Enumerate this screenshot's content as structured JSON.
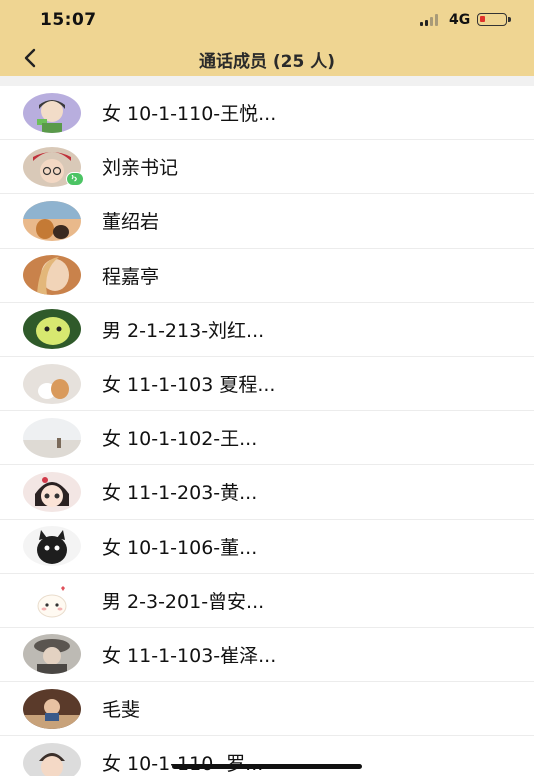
{
  "status_bar": {
    "time": "15:07",
    "network": "4G",
    "battery_color": "#e0322b"
  },
  "header": {
    "title": "通话成员 (25 人)",
    "background": "#efd592"
  },
  "members": [
    {
      "name": "女 10-1-110-王悦...",
      "avatar": "cartoon-girl"
    },
    {
      "name": "刘亲书记",
      "avatar": "child-glasses",
      "speaking": true
    },
    {
      "name": "董绍岩",
      "avatar": "dogs-sunset"
    },
    {
      "name": "程嘉亭",
      "avatar": "blonde-woman"
    },
    {
      "name": "男 2-1-213-刘红...",
      "avatar": "green-creature"
    },
    {
      "name": "女 11-1-103 夏程...",
      "avatar": "kittens"
    },
    {
      "name": "女 10-1-102-王...",
      "avatar": "beach-dog"
    },
    {
      "name": "女 11-1-203-黄...",
      "avatar": "anime-girl"
    },
    {
      "name": "女 10-1-106-董...",
      "avatar": "black-cat"
    },
    {
      "name": "男 2-3-201-曾安...",
      "avatar": "cute-bun"
    },
    {
      "name": "女 11-1-103-崔泽...",
      "avatar": "person-hat"
    },
    {
      "name": "毛斐",
      "avatar": "dinner-photo"
    },
    {
      "name": "女 10-1-110- 罗...",
      "avatar": "baby"
    }
  ]
}
